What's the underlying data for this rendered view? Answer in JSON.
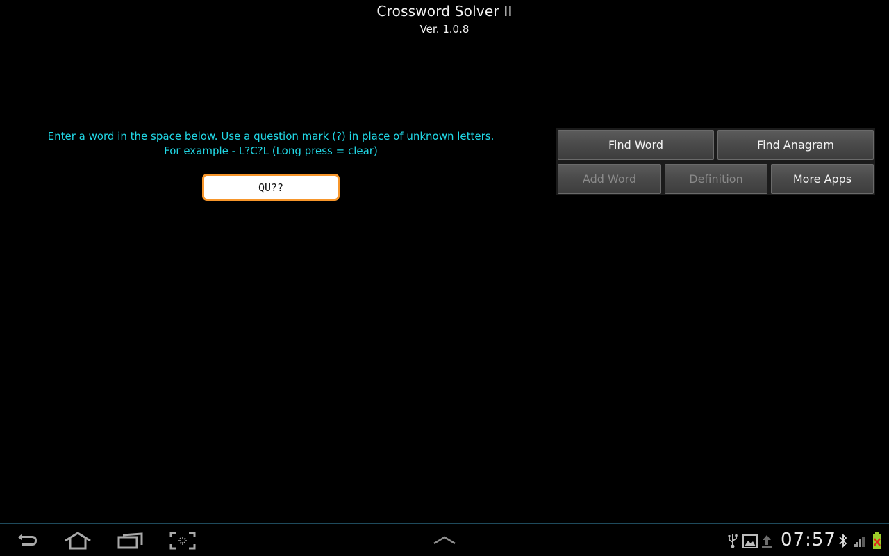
{
  "app": {
    "title": "Crossword Solver II",
    "version": "Ver. 1.0.8",
    "instructions_line1": "Enter a word in the space below. Use a question mark (?) in place of unknown letters.",
    "instructions_line2": "For example - L?C?L (Long press = clear)",
    "word_input_value": "QU??",
    "buttons": {
      "find_word": "Find Word",
      "find_anagram": "Find Anagram",
      "add_word": "Add Word",
      "definition": "Definition",
      "more_apps": "More Apps"
    },
    "colors": {
      "instructions": "#21d8e6",
      "input_border": "#f7962b",
      "disabled_text": "#8a8a8a"
    }
  },
  "system_bar": {
    "nav_icons": [
      "back-icon",
      "home-icon",
      "recent-apps-icon",
      "screenshot-icon"
    ],
    "center_icon": "chevron-up-icon",
    "status_icons": [
      "usb-icon",
      "gallery-icon",
      "upload-icon",
      "bluetooth-icon",
      "signal-icon",
      "battery-icon"
    ],
    "clock": "07:57"
  }
}
